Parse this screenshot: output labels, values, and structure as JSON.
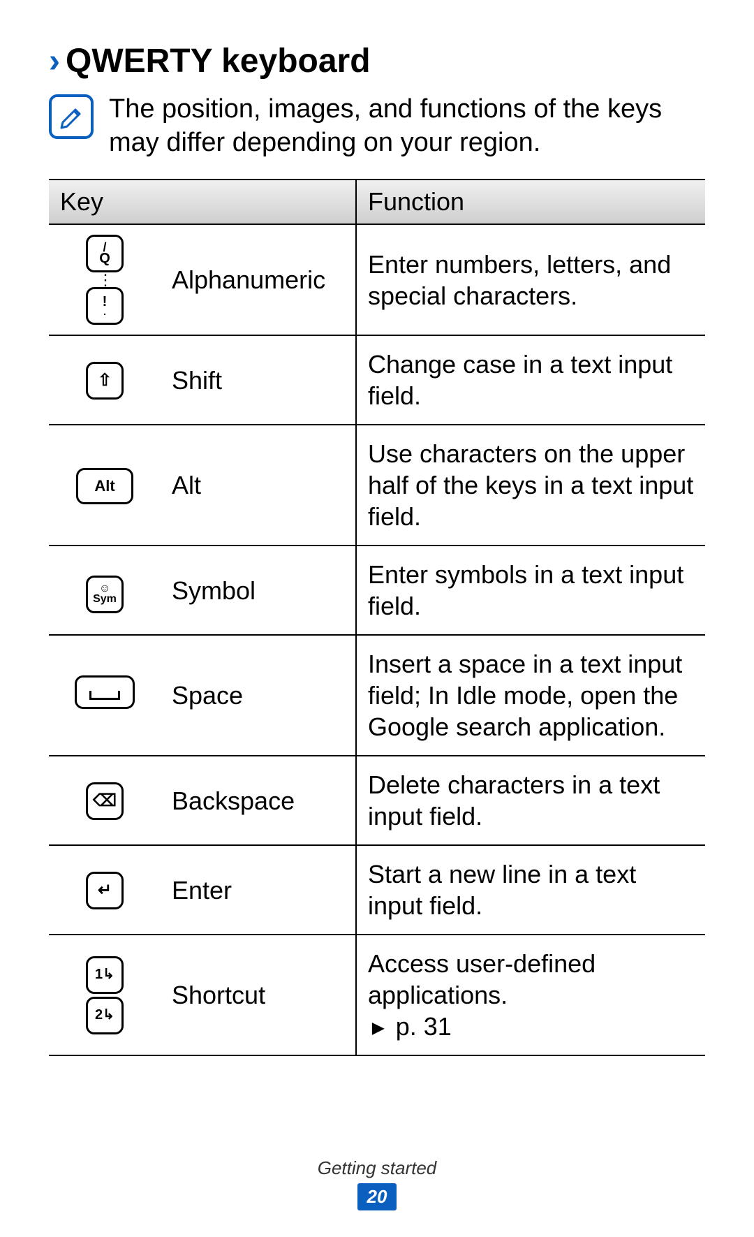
{
  "heading": {
    "chevron": "›",
    "title": "QWERTY keyboard"
  },
  "note": "The position, images, and functions of the keys may differ depending on your region.",
  "table": {
    "header_key": "Key",
    "header_function": "Function",
    "rows": [
      {
        "name": "Alphanumeric",
        "function": "Enter numbers, letters, and special characters."
      },
      {
        "name": "Shift",
        "function": "Change case in a text input field."
      },
      {
        "name": "Alt",
        "function": "Use characters on the upper half of the keys in a text input field."
      },
      {
        "name": "Symbol",
        "function": "Enter symbols in a text input field."
      },
      {
        "name": "Space",
        "function": "Insert a space in a text input field; In Idle mode, open the Google search application."
      },
      {
        "name": "Backspace",
        "function": "Delete characters in a text input field."
      },
      {
        "name": "Enter",
        "function": "Start a new line in a text input field."
      },
      {
        "name": "Shortcut",
        "function": "Access user-defined applications."
      }
    ],
    "shortcut_page_ref": "p. 31"
  },
  "icons": {
    "alphanumeric_top_upper": "/",
    "alphanumeric_top_lower": "Q",
    "alphanumeric_bottom_upper": "!",
    "alphanumeric_bottom_lower": ".",
    "shift": "⇧",
    "alt": "Alt",
    "symbol": "Sym",
    "backspace": "⌫",
    "enter": "↵",
    "shortcut1": "1↳",
    "shortcut2": "2↳"
  },
  "footer": {
    "section": "Getting started",
    "page": "20"
  }
}
